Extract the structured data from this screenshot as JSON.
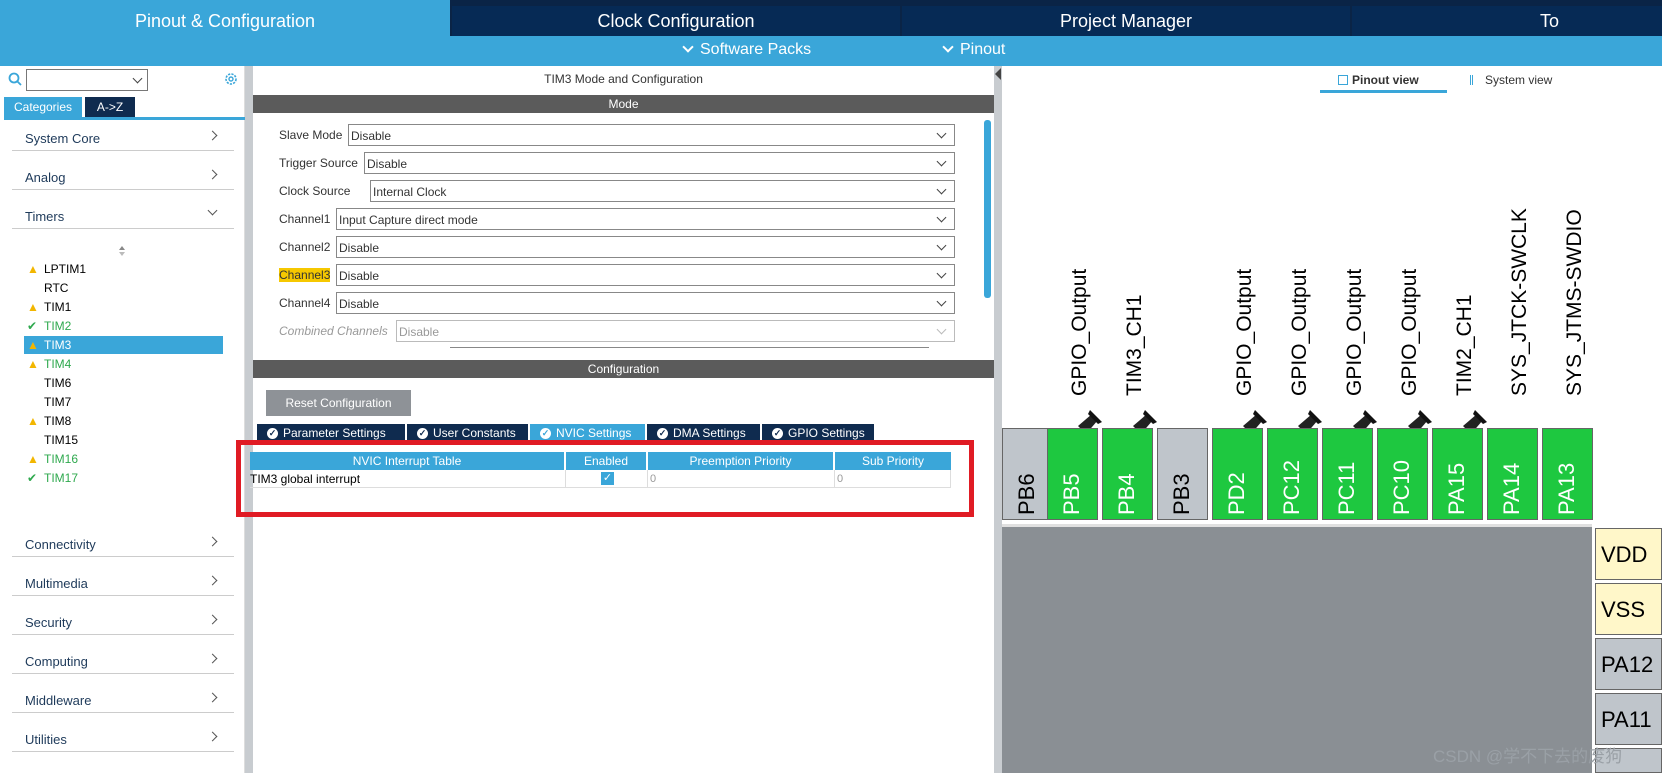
{
  "top_tabs": [
    {
      "label": "Pinout & Configuration"
    },
    {
      "label": "Clock Configuration"
    },
    {
      "label": "Project Manager"
    },
    {
      "label": "To"
    }
  ],
  "sub_bar": {
    "software_packs": "Software Packs",
    "pinout": "Pinout"
  },
  "left": {
    "cat_tab_categories": "Categories",
    "cat_tab_az": "A->Z",
    "categories": [
      "System Core",
      "Analog",
      "Timers",
      "Connectivity",
      "Multimedia",
      "Security",
      "Computing",
      "Middleware",
      "Utilities"
    ],
    "timers": [
      {
        "name": "LPTIM1",
        "status": "warning"
      },
      {
        "name": "RTC",
        "status": "none"
      },
      {
        "name": "TIM1",
        "status": "warning"
      },
      {
        "name": "TIM2",
        "status": "ok"
      },
      {
        "name": "TIM3",
        "status": "warning",
        "selected": true
      },
      {
        "name": "TIM4",
        "status": "warning"
      },
      {
        "name": "TIM6",
        "status": "none"
      },
      {
        "name": "TIM7",
        "status": "none"
      },
      {
        "name": "TIM8",
        "status": "warning"
      },
      {
        "name": "TIM15",
        "status": "none"
      },
      {
        "name": "TIM16",
        "status": "warning"
      },
      {
        "name": "TIM17",
        "status": "ok"
      }
    ]
  },
  "mid": {
    "title": "TIM3 Mode and Configuration",
    "mode_band": "Mode",
    "mode_rows": [
      {
        "label": "Slave Mode",
        "value": "Disable"
      },
      {
        "label": "Trigger Source",
        "value": "Disable"
      },
      {
        "label": "Clock Source",
        "value": "Internal Clock"
      },
      {
        "label": "Channel1",
        "value": "Input Capture direct mode"
      },
      {
        "label": "Channel2",
        "value": "Disable"
      },
      {
        "label": "Channel3",
        "value": "Disable"
      },
      {
        "label": "Channel4",
        "value": "Disable"
      },
      {
        "label": "Combined Channels",
        "value": "Disable"
      }
    ],
    "config_band": "Configuration",
    "reset_button": "Reset Configuration",
    "config_tabs": [
      "Parameter Settings",
      "User Constants",
      "NVIC Settings",
      "DMA Settings",
      "GPIO Settings"
    ],
    "nvic_table": {
      "headers": [
        "NVIC Interrupt Table",
        "Enabled",
        "Preemption Priority",
        "Sub Priority"
      ],
      "rows": [
        {
          "name": "TIM3 global interrupt",
          "enabled": true,
          "preemption": "0",
          "sub": "0"
        }
      ]
    }
  },
  "right": {
    "pinout_view": "Pinout view",
    "system_view": "System view",
    "pins": [
      "PB6",
      "PB5",
      "PB4",
      "PB3",
      "PD2",
      "PC12",
      "PC11",
      "PC10",
      "PA15",
      "PA14",
      "PA13"
    ],
    "signals": [
      "GPIO_Output",
      "TIM3_CH1",
      "GPIO_Output",
      "GPIO_Output",
      "GPIO_Output",
      "GPIO_Output",
      "TIM2_CH1",
      "SYS_JTCK-SWCLK",
      "SYS_JTMS-SWDIO"
    ],
    "side_pins": [
      "VDD",
      "VSS",
      "PA12",
      "PA11"
    ]
  },
  "watermark": "CSDN @学不下去的废狗",
  "colors": {
    "accent": "#3aa6d9",
    "navy": "#062a55",
    "pin_green": "#1ec840",
    "highlight": "#e01b24"
  }
}
